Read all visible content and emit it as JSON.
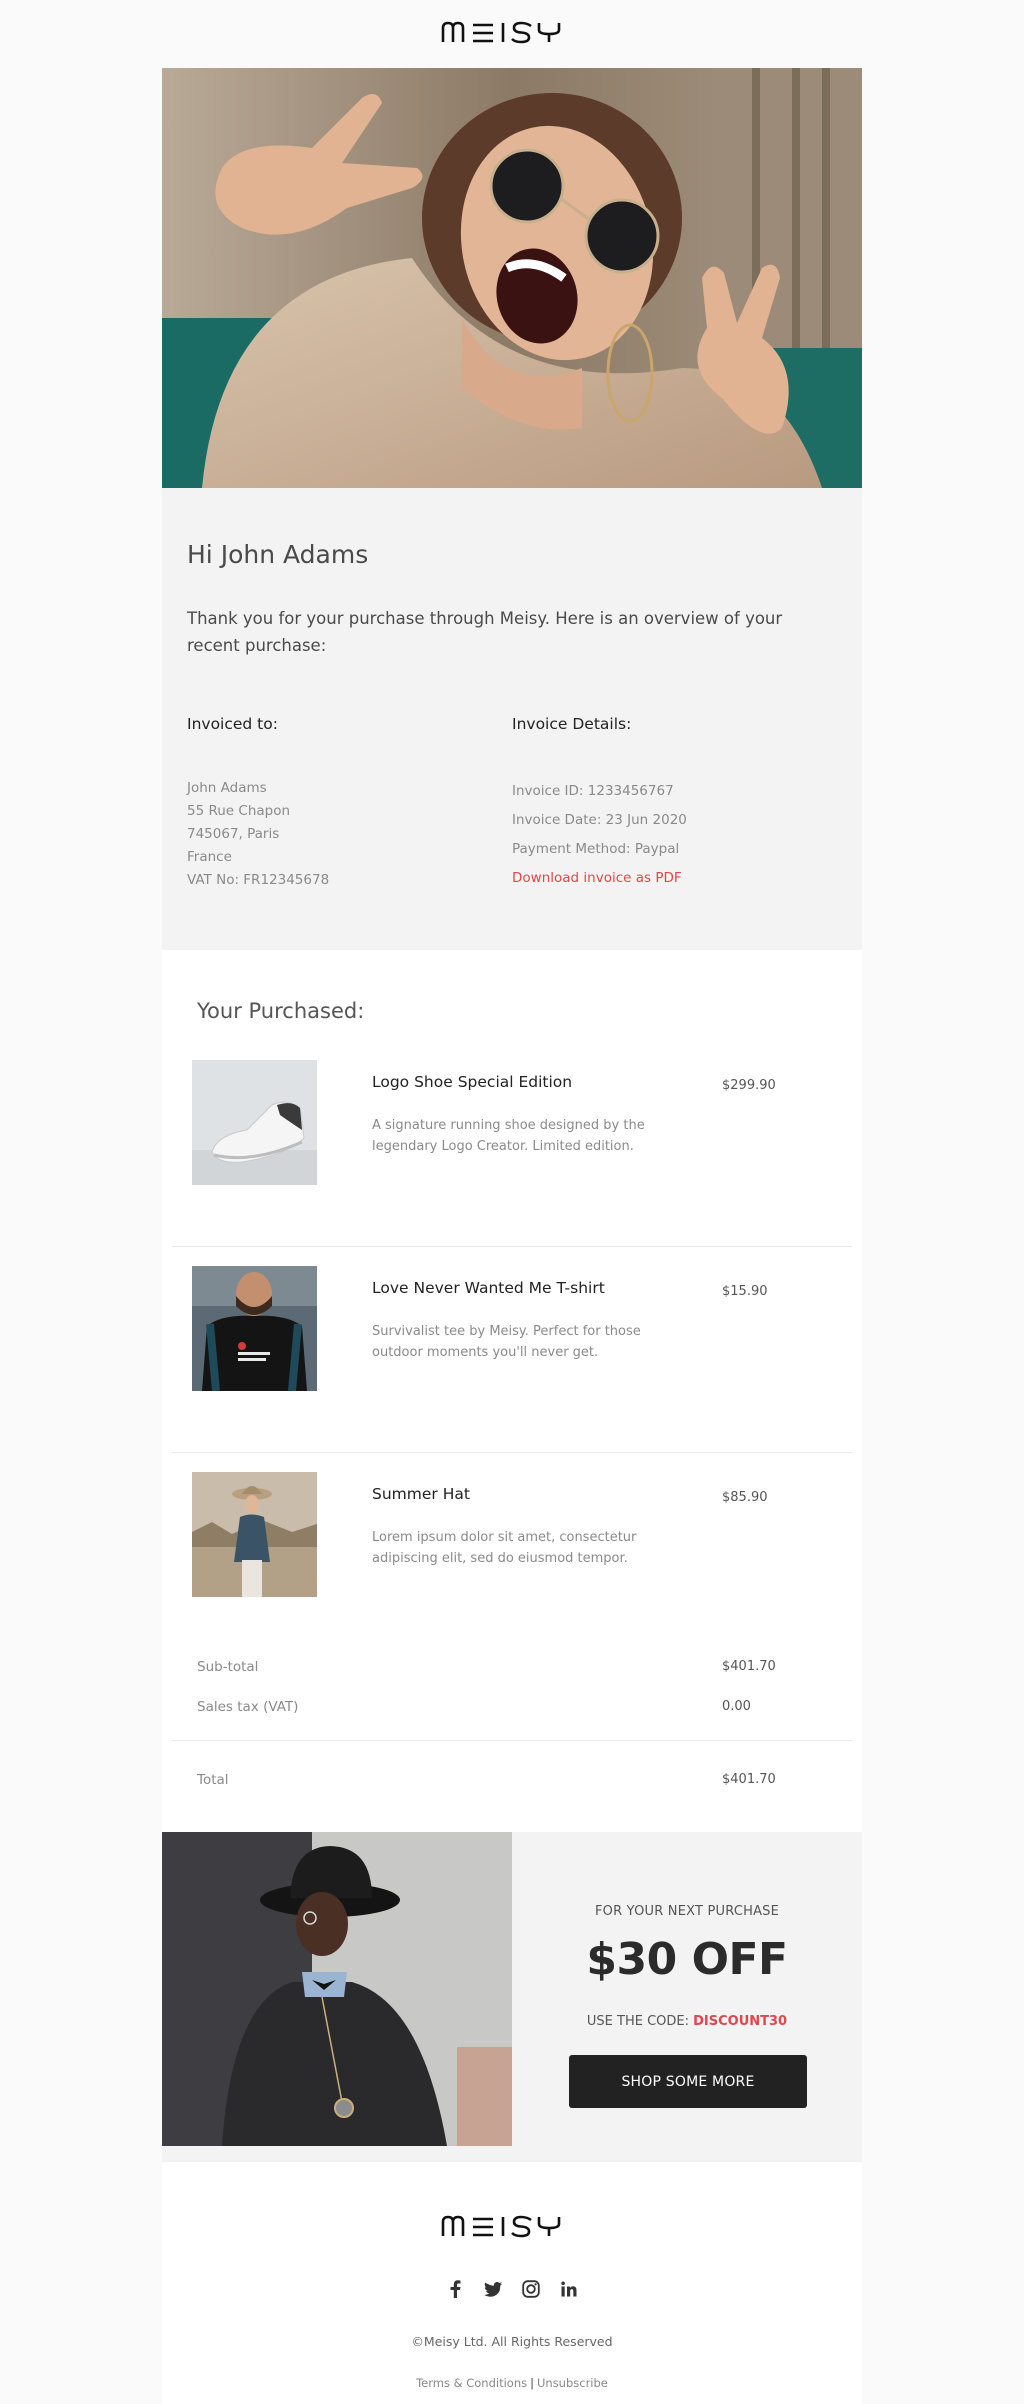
{
  "brand": {
    "name": "MEISY"
  },
  "greeting": {
    "title": "Hi John Adams",
    "intro": "Thank you for your purchase through Meisy. Here is an overview of your recent purchase:"
  },
  "invoice": {
    "to_heading": "Invoiced to:",
    "to_lines": [
      "John Adams",
      "55 Rue Chapon",
      "745067, Paris",
      "France",
      "VAT No: FR12345678"
    ],
    "details_heading": "Invoice Details:",
    "id": "Invoice ID: 1233456767",
    "date": "Invoice Date: 23 Jun 2020",
    "payment": "Payment Method: Paypal",
    "download_label": "Download invoice as PDF"
  },
  "purchases": {
    "title": "Your Purchased:",
    "items": [
      {
        "name": "Logo Shoe Special Edition",
        "description": "A signature running shoe designed by the legendary Logo Creator. Limited edition.",
        "price": "$299.90"
      },
      {
        "name": "Love Never Wanted Me T-shirt",
        "description": "Survivalist tee by Meisy. Perfect for those outdoor moments you'll never get.",
        "price": "$15.90"
      },
      {
        "name": "Summer Hat",
        "description": "Lorem ipsum dolor sit amet, consectetur adipiscing elit, sed do eiusmod tempor.",
        "price": "$85.90"
      }
    ],
    "subtotal_label": "Sub-total",
    "subtotal_value": "$401.70",
    "tax_label": "Sales tax (VAT)",
    "tax_value": "0.00",
    "total_label": "Total",
    "total_value": "$401.70"
  },
  "promo": {
    "kicker": "FOR YOUR NEXT PURCHASE",
    "amount": "$30 OFF",
    "code_prefix": "USE THE CODE: ",
    "code": "DISCOUNT30",
    "button_label": "SHOP SOME MORE"
  },
  "footer": {
    "social_icons": [
      "facebook-icon",
      "twitter-icon",
      "instagram-icon",
      "linkedin-icon"
    ],
    "copyright": "©Meisy Ltd. All Rights Reserved",
    "terms_label": "Terms & Conditions",
    "separator": "|",
    "unsubscribe_label": "Unsubscribe"
  },
  "colors": {
    "accent": "#e0474c",
    "dark": "#222222",
    "panel": "#f3f3f3"
  }
}
